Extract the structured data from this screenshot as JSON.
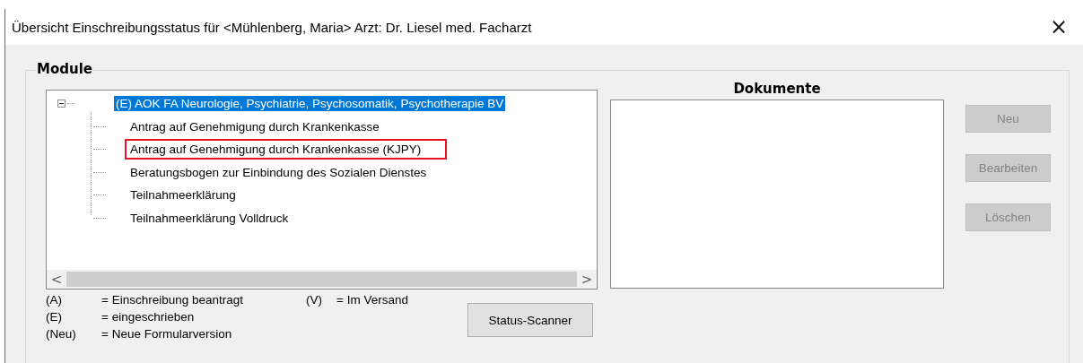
{
  "window": {
    "title": "Übersicht Einschreibungsstatus für <Mühlenberg, Maria> Arzt: Dr. Liesel med. Facharzt",
    "close": "×"
  },
  "modules": {
    "title": "Module",
    "tree": [
      {
        "label": "(E) AOK FA Neurologie, Psychiatrie, Psychosomatik, Psychotherapie BV",
        "selected": true,
        "expanded": true,
        "children": [
          {
            "label": "Antrag auf Genehmigung durch Krankenkasse",
            "selected": false,
            "marked": false
          },
          {
            "label": "Antrag auf Genehmigung durch Krankenkasse (KJPY)",
            "selected": false,
            "marked": true
          },
          {
            "label": "Beratungsbogen zur Einbindung des Sozialen Dienstes",
            "selected": false,
            "marked": false
          },
          {
            "label": "Teilnahmeerklärung",
            "selected": false,
            "marked": false
          },
          {
            "label": "Teilnahmeerklärung Volldruck",
            "selected": false,
            "marked": false
          }
        ]
      }
    ],
    "scroll_left": "<",
    "scroll_right": ">"
  },
  "legend": [
    [
      {
        "code": "(A)",
        "text": "= Einschreibung beantragt"
      },
      {
        "code": "(V)",
        "text": "= Im Versand"
      }
    ],
    [
      {
        "code": "(E)",
        "text": "= eingeschrieben"
      }
    ],
    [
      {
        "code": "(Neu)",
        "text": "= Neue Formularversion"
      }
    ]
  ],
  "status_scanner": {
    "label": "Status-Scanner",
    "disabled": false
  },
  "documents": {
    "title": "Dokumente"
  },
  "buttons": [
    {
      "label": "Neu",
      "disabled": true
    },
    {
      "label": "Bearbeiten",
      "disabled": true
    },
    {
      "label": "Löschen",
      "disabled": true
    }
  ]
}
